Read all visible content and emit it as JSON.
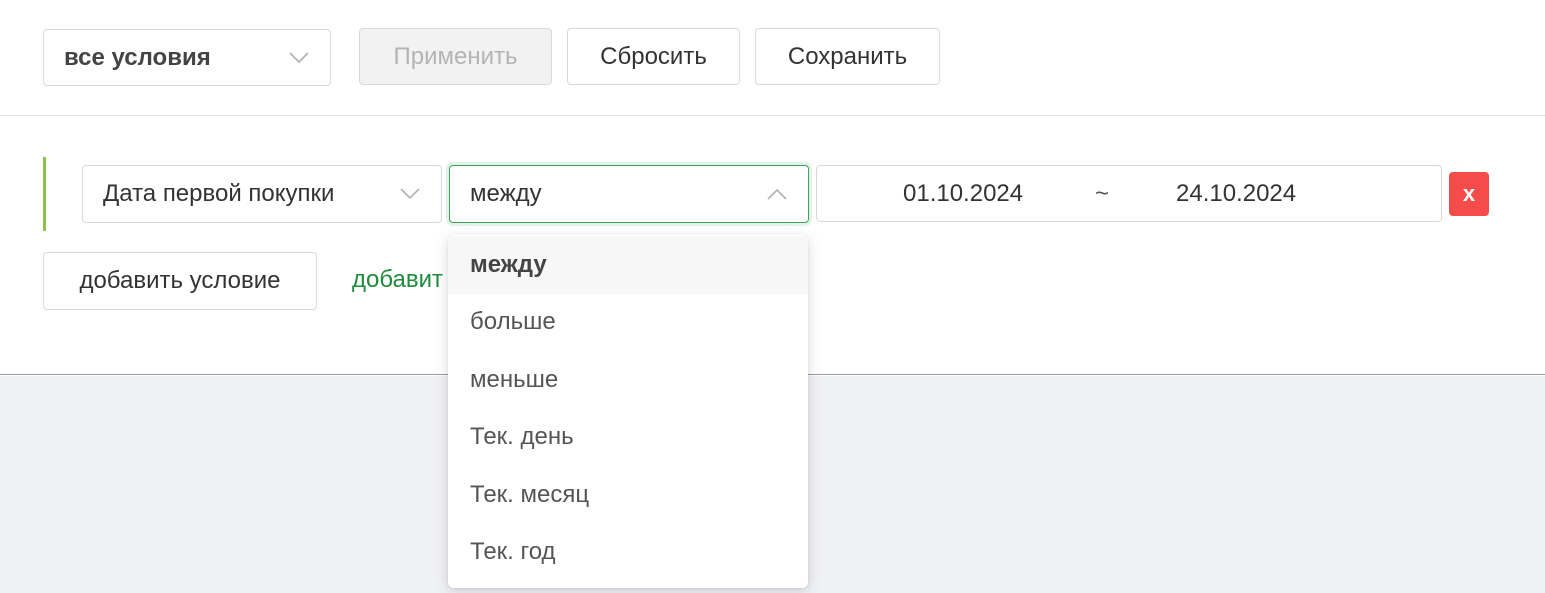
{
  "toolbar": {
    "mode_select": {
      "value": "все условия"
    },
    "apply_label": "Применить",
    "reset_label": "Сбросить",
    "save_label": "Сохранить"
  },
  "condition": {
    "field": "Дата первой покупки",
    "operator": "между",
    "date_from": "01.10.2024",
    "date_separator": "~",
    "date_to": "24.10.2024",
    "remove_label": "x"
  },
  "actions": {
    "add_condition_label": "добавить условие",
    "add_group_label": "добавит"
  },
  "operator_dropdown": {
    "options": [
      "между",
      "больше",
      "меньше",
      "Тек. день",
      "Тек. месяц",
      "Тек. год"
    ],
    "selected": "между"
  },
  "colors": {
    "accent_green": "#3fa55b",
    "link_green": "#1e8c3b",
    "condition_bar": "#8bc34a",
    "danger": "#f44b4b",
    "page_bg": "#f0f1f5"
  }
}
